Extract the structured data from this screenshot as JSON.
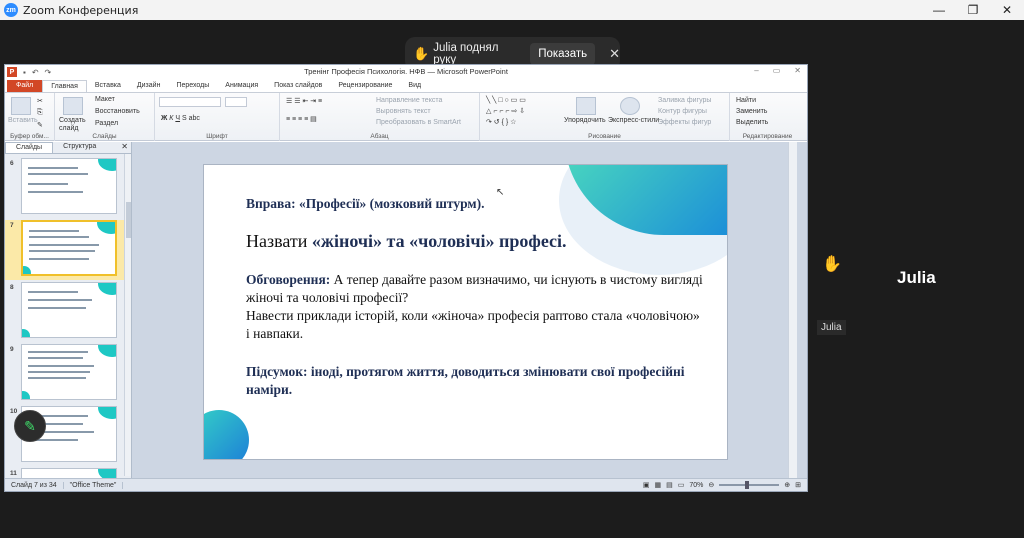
{
  "zoom": {
    "logo": "zm",
    "title": "Zoom Конференция",
    "minimize": "—",
    "maximize": "❐",
    "close": "✕"
  },
  "notification": {
    "hand_icon": "raised-hand-icon",
    "text": "Julia поднял руку",
    "show_label": "Показать",
    "close": "✕"
  },
  "ppt": {
    "app_icon": "P",
    "doc_title": "Тренінг Професія Психологія. НФВ — Microsoft PowerPoint",
    "ribbon_tabs": [
      "Главная",
      "Вставка",
      "Дизайн",
      "Переходы",
      "Анимация",
      "Показ слайдов",
      "Рецензирование",
      "Вид"
    ],
    "file_tab": "Файл",
    "groups": {
      "clipboard": {
        "label": "Буфер обм...",
        "paste": "Вставить"
      },
      "slides": {
        "label": "Слайды",
        "create": "Создать слайд",
        "layout": "Макет",
        "reset": "Восстановить",
        "section": "Раздел"
      },
      "font": {
        "label": "Шрифт"
      },
      "paragraph": {
        "label": "Абзац",
        "text_dir": "Направление текста",
        "align_text": "Выровнять текст",
        "smartart": "Преобразовать в SmartArt"
      },
      "drawing": {
        "label": "Рисование",
        "arrange": "Упорядочить",
        "quick_styles": "Экспресс-стили",
        "fill": "Заливка фигуры",
        "outline": "Контур фигуры",
        "effects": "Эффекты фигур"
      },
      "editing": {
        "label": "Редактирование",
        "find": "Найти",
        "replace": "Заменить",
        "select": "Выделить"
      }
    },
    "panel_tabs": [
      "Слайды",
      "Структура"
    ],
    "thumbnails": [
      {
        "num": "6",
        "selected": false
      },
      {
        "num": "7",
        "selected": true
      },
      {
        "num": "8",
        "selected": false
      },
      {
        "num": "9",
        "selected": false
      },
      {
        "num": "10",
        "selected": false
      },
      {
        "num": "11",
        "selected": false
      }
    ],
    "slide": {
      "title": "Вправа: «Професії» (мозковий штурм).",
      "head_pre": "Назвати ",
      "head_bold": "«жіночі» та «чоловічі» професі.",
      "discussion_label": "Обговорення:",
      "discussion_text": " А тепер давайте разом визначимо, чи існують в чистому вигляді жіночі та чоловічі професії?",
      "examples_text": "Навести приклади історій, коли «жіноча» професія раптово стала «чоловічою» і навпаки.",
      "summary": "Підсумок: іноді, протягом життя, доводиться змінювати свої професійні наміри."
    },
    "status": {
      "slide_num": "Слайд 7 из 34",
      "theme": "\"Office Theme\"",
      "zoom": "70%"
    }
  },
  "participant": {
    "hand_icon": "raised-hand-icon",
    "name": "Julia",
    "tag": "Julia"
  },
  "edit_button_icon": "pencil-icon"
}
